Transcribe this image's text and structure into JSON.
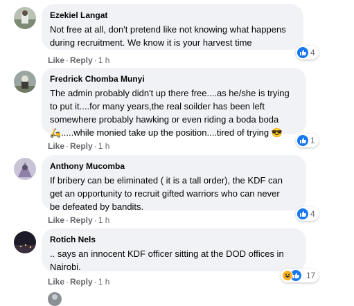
{
  "comments": [
    {
      "author": "Ezekiel Langat",
      "lines": [
        "Not free at all, don't pretend like not knowing what happens",
        "during recruitment. We know it is your harvest time"
      ],
      "actions": {
        "like": "Like",
        "reply": "Reply",
        "time": "1 h"
      },
      "reactions": {
        "icons": [
          "like-icon"
        ],
        "count": "4"
      }
    },
    {
      "author": "Fredrick Chomba Munyi",
      "lines": [
        "The admin probably didn't up there free....as he/she is trying",
        "to put it....for many years,the real soilder has been left",
        "somewhere probably hawking or even riding a boda boda"
      ],
      "last_line": ".....while monied take up the position....tired of trying",
      "actions": {
        "like": "Like",
        "reply": "Reply",
        "time": "1 h"
      },
      "reactions": {
        "icons": [
          "like-icon"
        ],
        "count": "1"
      }
    },
    {
      "author": "Anthony Mucomba",
      "lines": [
        "If bribery can be eliminated ( it is a tall order), the KDF can",
        "get an opportunity to recruit gifted warriors who can never",
        "be defeated by bandits."
      ],
      "actions": {
        "like": "Like",
        "reply": "Reply",
        "time": "1 h"
      },
      "reactions": {
        "icons": [
          "like-icon"
        ],
        "count": "4"
      }
    },
    {
      "author": "Rotich Nels",
      "lines": [
        ".. says an innocent KDF officer sitting at the DOD offices in",
        "Nairobi."
      ],
      "actions": {
        "like": "Like",
        "reply": "Reply",
        "time": "1 h"
      },
      "reactions": {
        "icons": [
          "haha-icon",
          "like-icon"
        ],
        "count": "17"
      }
    }
  ],
  "colors": {
    "bubble": "#f0f2f5",
    "like": "#1877f2",
    "meta": "#65676b"
  }
}
